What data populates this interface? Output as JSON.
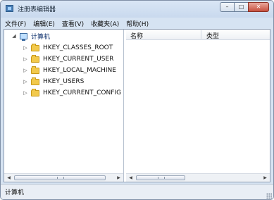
{
  "window": {
    "title": "注册表编辑器",
    "app_icon": "registry-editor-icon",
    "controls": {
      "minimize": "–",
      "maximize": "□",
      "close": "✕"
    }
  },
  "menubar": {
    "items": [
      {
        "label": "文件(F)"
      },
      {
        "label": "编辑(E)"
      },
      {
        "label": "查看(V)"
      },
      {
        "label": "收藏夹(A)"
      },
      {
        "label": "帮助(H)"
      }
    ]
  },
  "tree": {
    "root": {
      "label": "计算机",
      "icon": "computer-icon",
      "expander": "◢"
    },
    "items": [
      {
        "label": "HKEY_CLASSES_ROOT",
        "icon": "folder-icon",
        "expander": "▷"
      },
      {
        "label": "HKEY_CURRENT_USER",
        "icon": "folder-icon",
        "expander": "▷"
      },
      {
        "label": "HKEY_LOCAL_MACHINE",
        "icon": "folder-icon",
        "expander": "▷"
      },
      {
        "label": "HKEY_USERS",
        "icon": "folder-icon",
        "expander": "▷"
      },
      {
        "label": "HKEY_CURRENT_CONFIG",
        "icon": "folder-icon",
        "expander": "▷"
      }
    ]
  },
  "list": {
    "columns": {
      "name": "名称",
      "type": "类型"
    }
  },
  "scroll": {
    "left": "◀",
    "right": "▶"
  },
  "status": {
    "text": "计算机"
  }
}
